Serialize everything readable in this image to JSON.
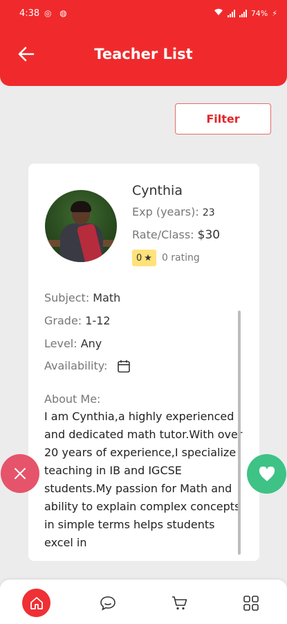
{
  "status_bar": {
    "time": "4:38",
    "battery": "74%"
  },
  "header": {
    "title": "Teacher List",
    "back_icon": "arrow-left-icon",
    "color": "#f02a2c"
  },
  "filter": {
    "label": "Filter"
  },
  "teacher": {
    "name": "Cynthia",
    "exp_label": "Exp (years):",
    "exp_value": "23",
    "rate_label": "Rate/Class:",
    "rate_value": "$30",
    "rating_value": "0",
    "rating_text": "0 rating",
    "subject_label": "Subject:",
    "subject_value": "Math",
    "grade_label": "Grade:",
    "grade_value": "1-12",
    "level_label": "Level:",
    "level_value": "Any",
    "availability_label": "Availability:",
    "about_label": "About Me:",
    "about_text": "I am Cynthia,a highly experienced and dedicated math tutor.With over 20 years of experience,I specialize teaching in IB and IGCSE students.My passion for Math and ability to explain complex concepts in simple terms helps students excel in"
  },
  "actions": {
    "reject_icon": "close-icon",
    "like_icon": "heart-icon",
    "reject_color": "#e5546b",
    "like_color": "#3ec286"
  },
  "bottom_nav": {
    "items": [
      "home-icon",
      "chat-icon",
      "cart-icon",
      "grid-icon"
    ],
    "active": "home-icon"
  }
}
